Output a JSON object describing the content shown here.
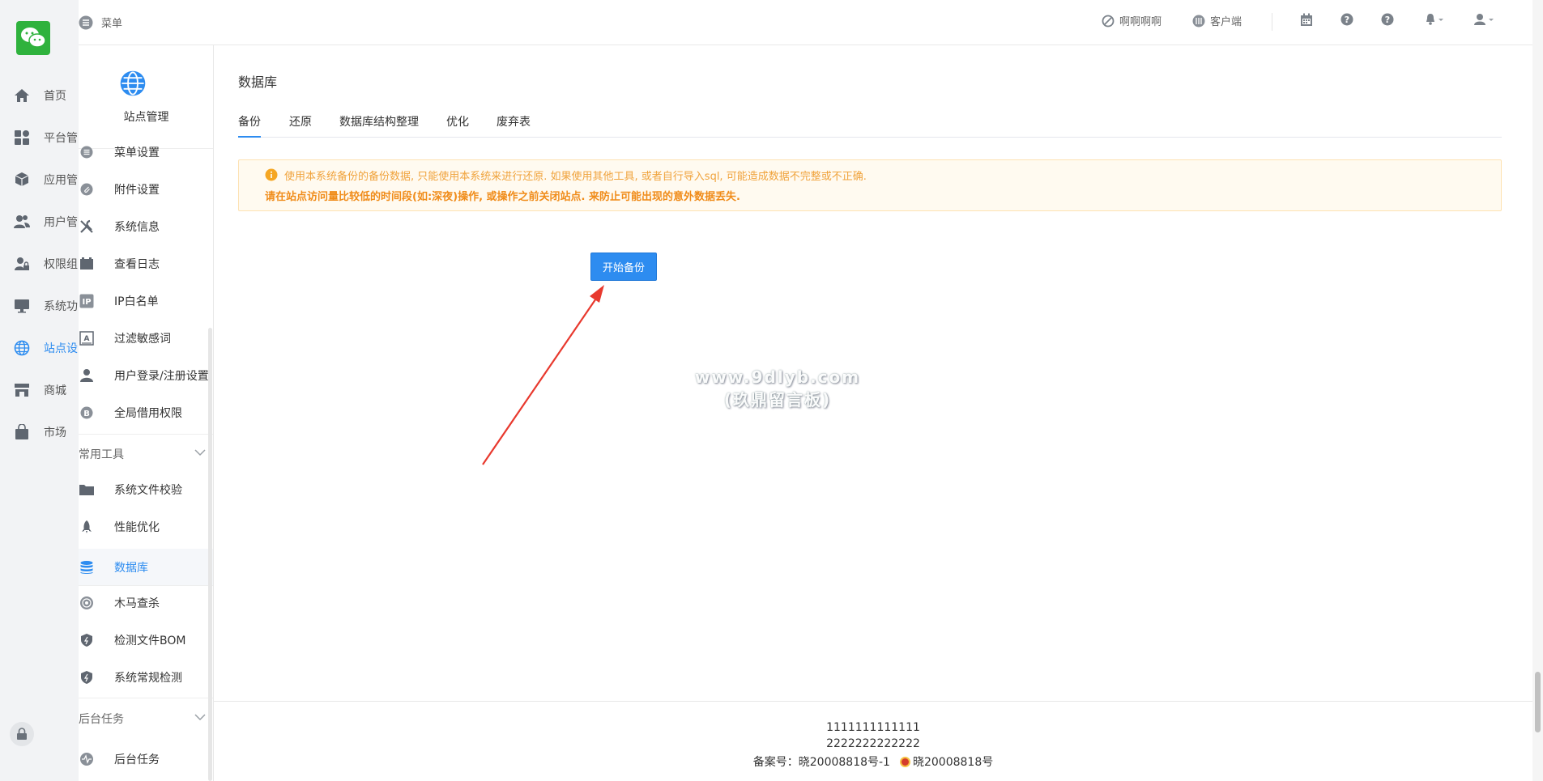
{
  "rail": {
    "items": [
      {
        "label": "首页",
        "icon": "home-icon"
      },
      {
        "label": "平台管",
        "icon": "grid-icon"
      },
      {
        "label": "应用管",
        "icon": "box-icon"
      },
      {
        "label": "用户管",
        "icon": "users-icon"
      },
      {
        "label": "权限组",
        "icon": "user-lock-icon"
      },
      {
        "label": "系统功",
        "icon": "monitor-icon"
      },
      {
        "label": "站点设",
        "icon": "globe-icon"
      },
      {
        "label": "商城",
        "icon": "store-icon"
      },
      {
        "label": "市场",
        "icon": "bag-icon"
      }
    ],
    "active_color": "#2d8cf0"
  },
  "header": {
    "menu_label": "菜单",
    "links": [
      "啊啊啊啊",
      "客户端"
    ]
  },
  "sidebar": {
    "title": "站点管理",
    "items": [
      "菜单设置",
      "附件设置",
      "系统信息",
      "查看日志",
      "IP白名单",
      "过滤敏感词",
      "用户登录/注册设置",
      "全局借用权限"
    ],
    "group_tools": "常用工具",
    "tools": [
      "系统文件校验",
      "性能优化",
      "数据库",
      "木马查杀",
      "检测文件BOM",
      "系统常规检测"
    ],
    "group_tasks": "后台任务",
    "tasks": [
      "后台任务"
    ]
  },
  "main": {
    "title": "数据库",
    "tabs": [
      "备份",
      "还原",
      "数据库结构整理",
      "优化",
      "废弃表"
    ],
    "alert_line1": "使用本系统备份的备份数据, 只能使用本系统来进行还原. 如果使用其他工具, 或者自行导入sql, 可能造成数据不完整或不正确.",
    "alert_line2": "请在站点访问量比较低的时间段(如:深夜)操作, 或操作之前关闭站点. 来防止可能出现的意外数据丢失.",
    "start_button": "开始备份"
  },
  "watermark": {
    "line1": "www.9dlyb.com",
    "line2": "(玖鼎留言板)"
  },
  "footer": {
    "line1": "1111111111111",
    "line2": "2222222222222",
    "icp": "备案号：晓20008818号-1",
    "police": "晓20008818号"
  }
}
